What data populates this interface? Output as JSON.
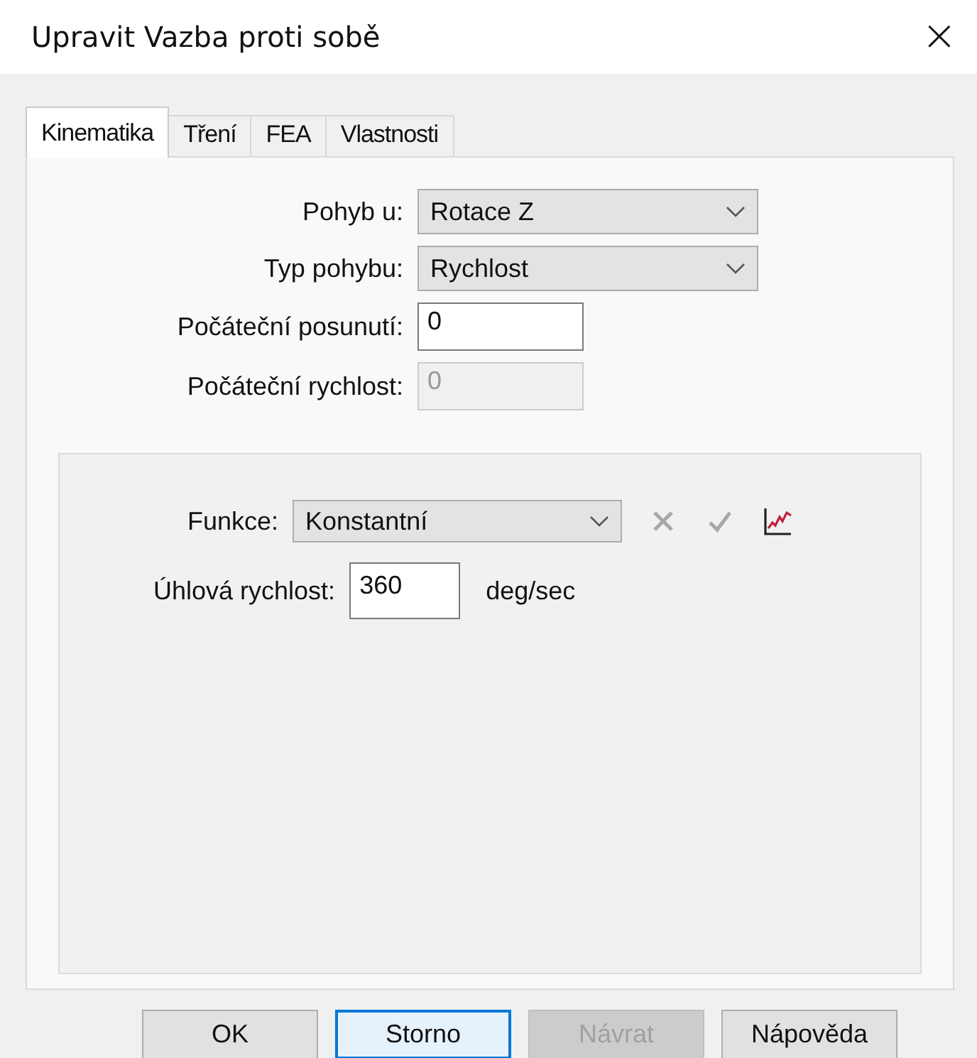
{
  "window": {
    "title": "Upravit Vazba proti sobě",
    "close": "×"
  },
  "tabs": [
    {
      "label": "Kinematika",
      "selected": true
    },
    {
      "label": "Tření",
      "selected": false
    },
    {
      "label": "FEA",
      "selected": false
    },
    {
      "label": "Vlastnosti",
      "selected": false
    }
  ],
  "fields": [
    {
      "label": "Pohyb u:",
      "kind": "combo",
      "value": "Rotace Z",
      "disabled": false
    },
    {
      "label": "Typ pohybu:",
      "kind": "combo",
      "value": "Rychlost",
      "disabled": false
    },
    {
      "label": "Počáteční posunutí:",
      "kind": "input",
      "value": "0",
      "disabled": false
    },
    {
      "label": "Počáteční rychlost:",
      "kind": "input",
      "value": "0",
      "disabled": true
    }
  ],
  "function_group": {
    "function": {
      "label": "Funkce:",
      "value": "Konstantní"
    },
    "actions": [
      {
        "kind": "delete",
        "disabled": true
      },
      {
        "kind": "apply",
        "disabled": true
      },
      {
        "kind": "graph",
        "disabled": false
      }
    ],
    "parameter": {
      "label": "Úhlová rychlost:",
      "value": "360",
      "unit": "deg/sec"
    }
  },
  "buttons": [
    {
      "label": "OK",
      "focused": false,
      "disabled": false
    },
    {
      "label": "Storno",
      "focused": true,
      "disabled": false
    },
    {
      "label": "Návrat",
      "focused": false,
      "disabled": true
    },
    {
      "label": "Nápověda",
      "focused": false,
      "disabled": false
    }
  ]
}
